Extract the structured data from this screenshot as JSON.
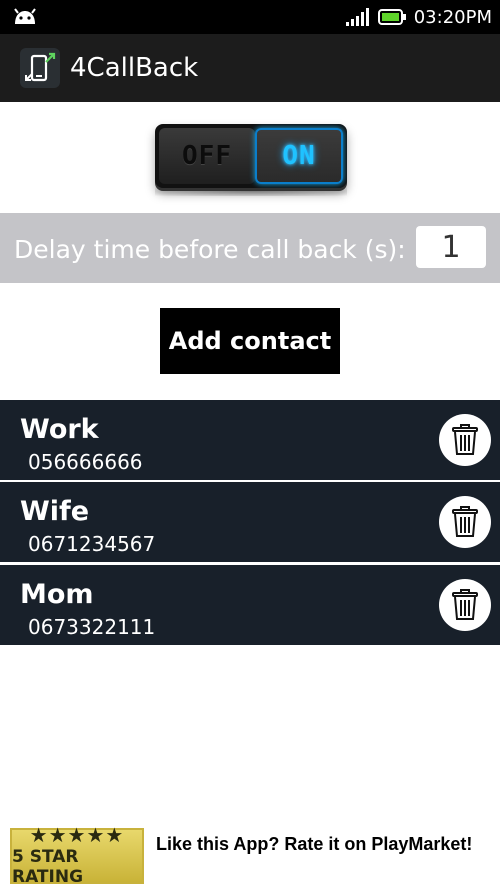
{
  "status_bar": {
    "time": "03:20PM",
    "icons": [
      "android-icon",
      "signal-icon",
      "battery-icon"
    ]
  },
  "app": {
    "title": "4CallBack",
    "icon": "phone-callback-icon"
  },
  "toggle": {
    "off_label": "OFF",
    "on_label": "ON",
    "state": "on",
    "accent_color": "#1fc2ff"
  },
  "delay": {
    "label": "Delay time before call back (s):",
    "value": "1"
  },
  "add_contact_label": "Add contact",
  "contacts": [
    {
      "name": "Work",
      "number": "056666666"
    },
    {
      "name": "Wife",
      "number": "0671234567"
    },
    {
      "name": "Mom",
      "number": "0673322111"
    }
  ],
  "rating": {
    "stars": "★★★★★",
    "badge_label": "5 STAR RATING",
    "text": "Like this App? Rate it on PlayMarket!"
  }
}
